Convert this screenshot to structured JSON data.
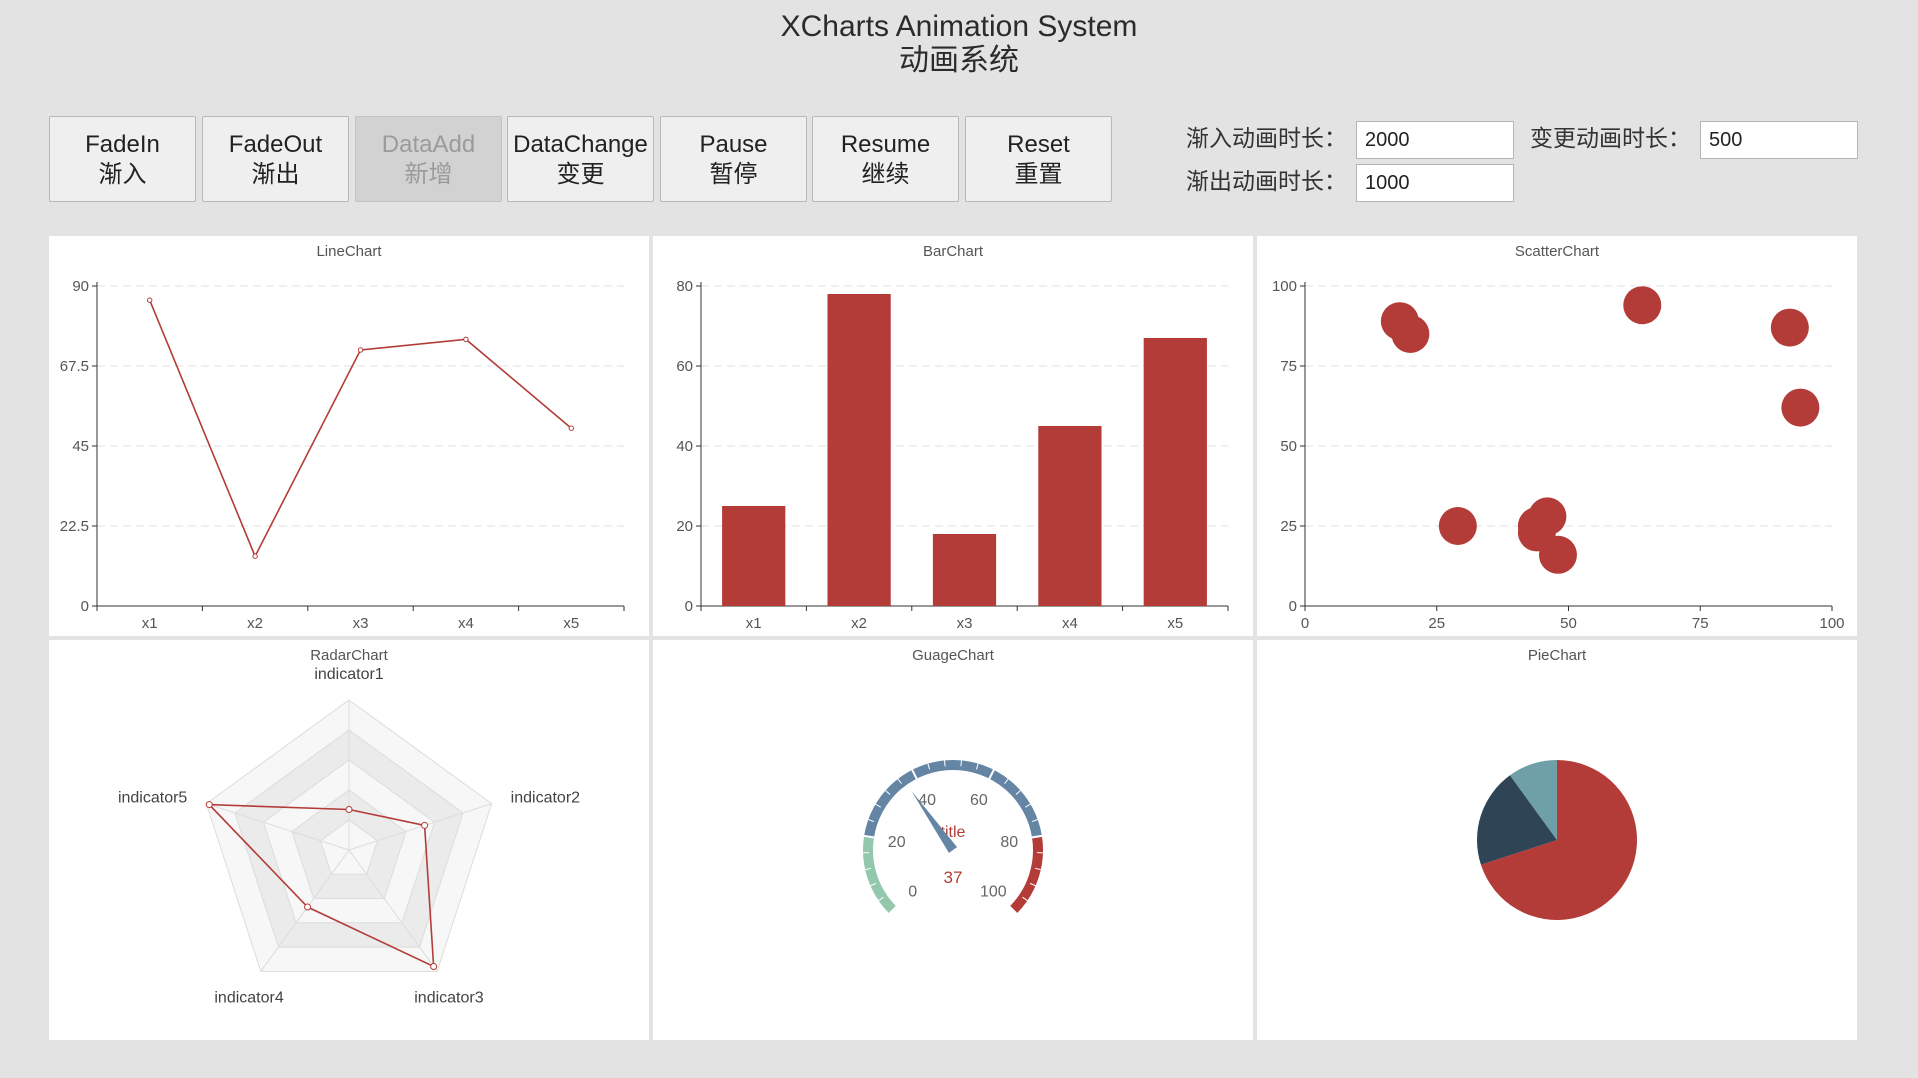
{
  "header": {
    "title_en": "XCharts Animation System",
    "title_zh": "动画系统"
  },
  "buttons": [
    {
      "en": "FadeIn",
      "zh": "渐入"
    },
    {
      "en": "FadeOut",
      "zh": "渐出"
    },
    {
      "en": "DataAdd",
      "zh": "新增",
      "disabled": true
    },
    {
      "en": "DataChange",
      "zh": "变更"
    },
    {
      "en": "Pause",
      "zh": "暂停"
    },
    {
      "en": "Resume",
      "zh": "继续"
    },
    {
      "en": "Reset",
      "zh": "重置"
    }
  ],
  "settings": {
    "fadein_label": "渐入动画时长：",
    "fadein_value": "2000",
    "change_label": "变更动画时长：",
    "change_value": "500",
    "fadeout_label": "渐出动画时长：",
    "fadeout_value": "1000"
  },
  "colors": {
    "primary": "#b33c38",
    "dark": "#2f4454",
    "teal": "#6f9fa7",
    "gauge_blue": "#6585a5",
    "gauge_green": "#93c8ad"
  },
  "chart_data": [
    {
      "type": "line",
      "title": "LineChart",
      "categories": [
        "x1",
        "x2",
        "x3",
        "x4",
        "x5"
      ],
      "values": [
        86,
        14,
        72,
        75,
        50
      ],
      "yticks": [
        "0",
        "22.5",
        "45",
        "67.5",
        "90"
      ],
      "ylim": [
        0,
        90
      ],
      "grid": true
    },
    {
      "type": "bar",
      "title": "BarChart",
      "categories": [
        "x1",
        "x2",
        "x3",
        "x4",
        "x5"
      ],
      "values": [
        25,
        78,
        18,
        45,
        67
      ],
      "yticks": [
        "0",
        "20",
        "40",
        "60",
        "80"
      ],
      "ylim": [
        0,
        80
      ],
      "grid": true
    },
    {
      "type": "scatter",
      "title": "ScatterChart",
      "points": [
        [
          18,
          89
        ],
        [
          20,
          85
        ],
        [
          64,
          94
        ],
        [
          92,
          87
        ],
        [
          94,
          62
        ],
        [
          29,
          25
        ],
        [
          44,
          25
        ],
        [
          46,
          28
        ],
        [
          44,
          23
        ],
        [
          48,
          16
        ]
      ],
      "xticks": [
        "0",
        "25",
        "50",
        "75",
        "100"
      ],
      "yticks": [
        "0",
        "25",
        "50",
        "75",
        "100"
      ],
      "xlim": [
        0,
        100
      ],
      "ylim": [
        0,
        100
      ],
      "grid": true
    },
    {
      "type": "radar",
      "title": "RadarChart",
      "indicators": [
        "indicator1",
        "indicator2",
        "indicator3",
        "indicator4",
        "indicator5"
      ],
      "values": [
        0.27,
        0.53,
        0.96,
        0.47,
        0.98
      ],
      "max": 1
    },
    {
      "type": "gauge",
      "title": "GuageChart",
      "value": 37,
      "detail": "37",
      "name": "title",
      "ticks": [
        "0",
        "20",
        "40",
        "60",
        "80",
        "100"
      ],
      "range": [
        0,
        100
      ]
    },
    {
      "type": "pie",
      "title": "PieChart",
      "slices": [
        {
          "value": 70,
          "color": "#b33c38"
        },
        {
          "value": 20,
          "color": "#2f4454"
        },
        {
          "value": 10,
          "color": "#6f9fa7"
        }
      ]
    }
  ]
}
